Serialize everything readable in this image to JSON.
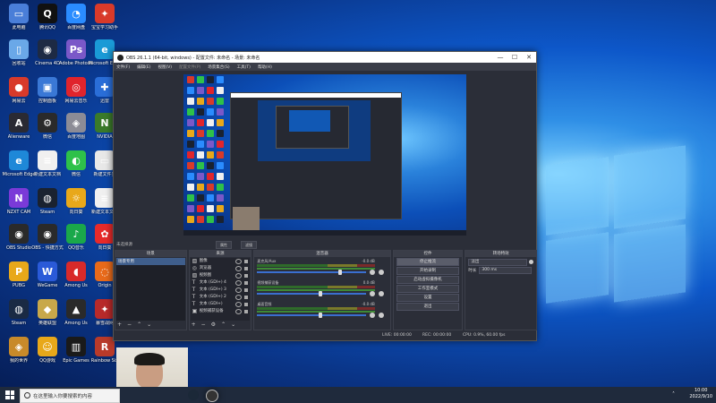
{
  "desktop": {
    "icons": [
      {
        "label": "此电脑",
        "color": "#4a7ed8",
        "glyph": "▭"
      },
      {
        "label": "腾讯QQ",
        "color": "#111111",
        "glyph": "Q"
      },
      {
        "label": "百度网盘",
        "color": "#2a8cff",
        "glyph": "◔"
      },
      {
        "label": "宝宝学习助手",
        "color": "#d83a2a",
        "glyph": "✦"
      },
      {
        "label": "WPS Office",
        "color": "#c8281d",
        "glyph": "W"
      },
      {
        "label": "LiveSet",
        "color": "#e23a4c",
        "glyph": "G"
      },
      {
        "label": "回收站",
        "color": "#6aa8e8",
        "glyph": "▯"
      },
      {
        "label": "Cinema 4D",
        "color": "#1d2a44",
        "glyph": "◉"
      },
      {
        "label": "Adobe Photoshop",
        "color": "#7a58c8",
        "glyph": "Ps"
      },
      {
        "label": "Microsoft Edge",
        "color": "#1a9ad6",
        "glyph": "e"
      },
      {
        "label": "网易云",
        "color": "#d83a2a",
        "glyph": "●"
      },
      {
        "label": "控制面板",
        "color": "#3a78d6",
        "glyph": "▣"
      },
      {
        "label": "网易云音乐",
        "color": "#e0242c",
        "glyph": "◎"
      },
      {
        "label": "迅雷",
        "color": "#2a6ed8",
        "glyph": "✚"
      },
      {
        "label": "Adobe Illustrator",
        "color": "#2f6cc8",
        "glyph": "Ai"
      },
      {
        "label": "Alienware",
        "color": "#2a2a33",
        "glyph": "A"
      },
      {
        "label": "微信",
        "color": "#2a2a2a",
        "glyph": "⚙"
      },
      {
        "label": "百度地图",
        "color": "#8c8c96",
        "glyph": "◈"
      },
      {
        "label": "NVIDIA",
        "color": "#3a7a2a",
        "glyph": "N"
      },
      {
        "label": "Microsoft Edge",
        "color": "#1e88d8",
        "glyph": "e"
      },
      {
        "label": "新建文本文档",
        "color": "#f0f0f0",
        "glyph": "≡"
      },
      {
        "label": "微信",
        "color": "#2ec14a",
        "glyph": "◐"
      },
      {
        "label": "新建文件夹",
        "color": "#e8e8e8",
        "glyph": "▭"
      },
      {
        "label": "NZXT CAM",
        "color": "#7a3ad8",
        "glyph": "N"
      },
      {
        "label": "Steam",
        "color": "#1a2230",
        "glyph": "◍"
      },
      {
        "label": "向日葵",
        "color": "#e8a81a",
        "glyph": "☼"
      },
      {
        "label": "新建文本文档",
        "color": "#f0f0f0",
        "glyph": "≡"
      },
      {
        "label": "OBS Studio",
        "color": "#2a2a2a",
        "glyph": "◉"
      },
      {
        "label": "OBS - 快捷方式",
        "color": "#2a2a2a",
        "glyph": "◉"
      },
      {
        "label": "QQ音乐",
        "color": "#1aa84a",
        "glyph": "♪"
      },
      {
        "label": "向日葵",
        "color": "#e82a2a",
        "glyph": "✿"
      },
      {
        "label": "PUBG",
        "color": "#e8a81a",
        "glyph": "P"
      },
      {
        "label": "WeGame",
        "color": "#2a5ad8",
        "glyph": "W"
      },
      {
        "label": "Among Us",
        "color": "#d82a2a",
        "glyph": "◖"
      },
      {
        "label": "Origin",
        "color": "#e86a1a",
        "glyph": "◌"
      },
      {
        "label": "Steam",
        "color": "#1a2a44",
        "glyph": "◍"
      },
      {
        "label": "英雄联盟",
        "color": "#c8a84a",
        "glyph": "◆"
      },
      {
        "label": "Among Us",
        "color": "#2a2a2a",
        "glyph": "▲"
      },
      {
        "label": "暴雪战网",
        "color": "#b82a2a",
        "glyph": "✦"
      },
      {
        "label": "我的世界",
        "color": "#c88a2a",
        "glyph": "◈"
      },
      {
        "label": "QQ游戏",
        "color": "#e8a81a",
        "glyph": "☺"
      },
      {
        "label": "Epic Games",
        "color": "#1a1a1a",
        "glyph": "▥"
      },
      {
        "label": "Rainbow Six",
        "color": "#b83a2a",
        "glyph": "R"
      }
    ]
  },
  "obs": {
    "title": "OBS 26.1.1 (64-bit, windows) - 配置文件: 未命名 - 场景: 未命名",
    "window_controls": {
      "minimize": "—",
      "maximize": "☐",
      "close": "✕"
    },
    "menu": [
      "文件(F)",
      "编辑(E)",
      "视图(V)",
      "配置文件(P)",
      "场景集合(S)",
      "工具(T)",
      "帮助(H)"
    ],
    "status_left": "未选择源",
    "status_buttons": [
      "属性",
      "滤镜"
    ],
    "docks": {
      "scenes": {
        "header": "场景",
        "items": [
          "场景专用"
        ]
      },
      "sources": {
        "header": "来源",
        "items": [
          {
            "name": "图像",
            "icon": "▧"
          },
          {
            "name": "浏览器",
            "icon": "◎"
          },
          {
            "name": "视频图",
            "icon": "▧"
          },
          {
            "name": "文本 (GDI+) 4",
            "icon": "T"
          },
          {
            "name": "文本 (GDI+) 3",
            "icon": "T"
          },
          {
            "name": "文本 (GDI+) 2",
            "icon": "T"
          },
          {
            "name": "文本 (GDI+)",
            "icon": "T"
          },
          {
            "name": "视频捕获设备",
            "icon": "▣"
          }
        ]
      },
      "mixer": {
        "header": "混音器",
        "channels": [
          {
            "name": "麦克风/Aux",
            "db": "-0.0 dB",
            "slider": 0.82
          },
          {
            "name": "视频捕获设备",
            "db": "0.0 dB",
            "slider": 0.62
          },
          {
            "name": "桌面音频",
            "db": "-0.0 dB",
            "slider": 0.62
          }
        ]
      },
      "controls": {
        "header": "控件",
        "buttons": [
          "停止推流",
          "开始录制",
          "启动虚拟摄像机",
          "工作室模式",
          "设置",
          "退出"
        ]
      },
      "transitions": {
        "header": "转场特效",
        "type": "淡出",
        "duration_label": "时长",
        "duration": "300 ms"
      }
    },
    "footer": {
      "live": "LIVE: 00:00:00",
      "rec": "REC: 00:00:00",
      "cpu": "CPU: 0.9%, 60.00 fps"
    }
  },
  "taskbar": {
    "search_placeholder": "在这里输入你要搜索的内容",
    "time": "10:00",
    "date": "2022/9/10"
  }
}
